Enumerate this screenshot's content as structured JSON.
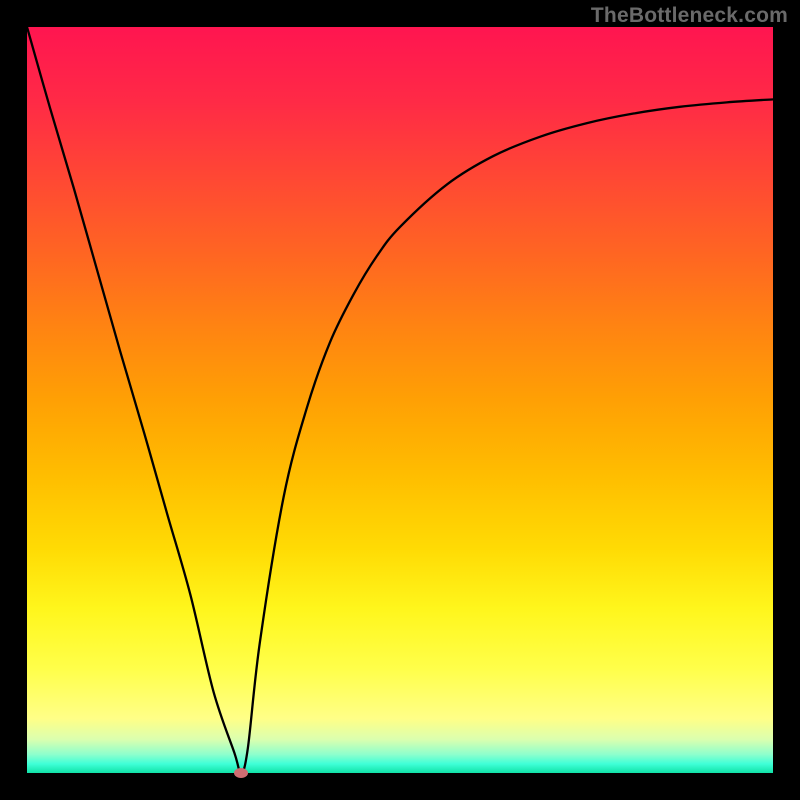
{
  "attribution": "TheBottleneck.com",
  "colors": {
    "border": "#000000",
    "attribution_text": "#6a6a6a",
    "curve": "#000000",
    "marker": "#cf6d72",
    "gradient_stops": [
      {
        "offset": 0.0,
        "hex": "#ff1550"
      },
      {
        "offset": 0.1,
        "hex": "#ff2a46"
      },
      {
        "offset": 0.2,
        "hex": "#ff4734"
      },
      {
        "offset": 0.3,
        "hex": "#ff6423"
      },
      {
        "offset": 0.4,
        "hex": "#ff8312"
      },
      {
        "offset": 0.5,
        "hex": "#ffa004"
      },
      {
        "offset": 0.6,
        "hex": "#ffbd00"
      },
      {
        "offset": 0.7,
        "hex": "#ffdb04"
      },
      {
        "offset": 0.78,
        "hex": "#fff61c"
      },
      {
        "offset": 0.86,
        "hex": "#ffff4a"
      },
      {
        "offset": 0.927,
        "hex": "#ffff87"
      },
      {
        "offset": 0.955,
        "hex": "#dbffaf"
      },
      {
        "offset": 0.975,
        "hex": "#8effcd"
      },
      {
        "offset": 0.988,
        "hex": "#3effd7"
      },
      {
        "offset": 1.0,
        "hex": "#11e2a7"
      }
    ]
  },
  "chart_data": {
    "type": "line",
    "title": "",
    "xlabel": "",
    "ylabel": "",
    "x_range": [
      0,
      100
    ],
    "y_range": [
      0,
      100
    ],
    "grid": false,
    "legend": false,
    "series": [
      {
        "name": "curve",
        "x": [
          0.0,
          3.1,
          6.3,
          9.4,
          12.5,
          15.7,
          18.8,
          21.9,
          25.0,
          27.8,
          28.7,
          29.6,
          31.2,
          34.4,
          37.5,
          40.6,
          43.8,
          46.9,
          50.0,
          56.3,
          62.5,
          68.8,
          75.0,
          81.3,
          87.5,
          93.8,
          100.0
        ],
        "y": [
          100.0,
          89.1,
          78.3,
          67.4,
          56.5,
          45.6,
          34.7,
          23.9,
          10.9,
          2.7,
          0.0,
          3.3,
          17.4,
          37.0,
          48.9,
          57.7,
          64.2,
          69.3,
          73.2,
          78.9,
          82.7,
          85.3,
          87.1,
          88.4,
          89.3,
          89.9,
          90.3
        ]
      }
    ],
    "marker": {
      "x": 28.7,
      "y": 0.0
    },
    "gradient_direction": "vertical_top_to_bottom"
  }
}
